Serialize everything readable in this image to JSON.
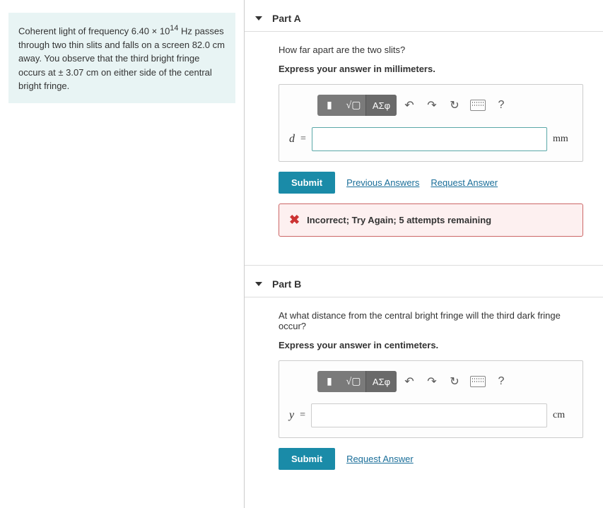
{
  "problem": {
    "text_pre": "Coherent light of frequency ",
    "freq_val": "6.40 × 10",
    "freq_exp": "14",
    "freq_unit": " Hz",
    "text_mid": " passes through two thin slits and falls on a screen ",
    "dist1": "82.0 cm",
    "text_mid2": " away. You observe that the third bright fringe occurs at ",
    "pm": "±",
    "dist2": " 3.07 cm",
    "text_end": " on either side of the central bright fringe."
  },
  "partA": {
    "title": "Part A",
    "question": "How far apart are the two slits?",
    "instruction": "Express your answer in millimeters.",
    "var": "d",
    "eq": "=",
    "unit": "mm",
    "submit": "Submit",
    "prev": "Previous Answers",
    "req": "Request Answer",
    "feedback": "Incorrect; Try Again; 5 attempts remaining"
  },
  "partB": {
    "title": "Part B",
    "question": "At what distance from the central bright fringe will the third dark fringe occur?",
    "instruction": "Express your answer in centimeters.",
    "var": "y",
    "eq": "=",
    "unit": "cm",
    "submit": "Submit",
    "req": "Request Answer"
  },
  "toolbar": {
    "greek": "ΑΣφ",
    "help": "?"
  }
}
